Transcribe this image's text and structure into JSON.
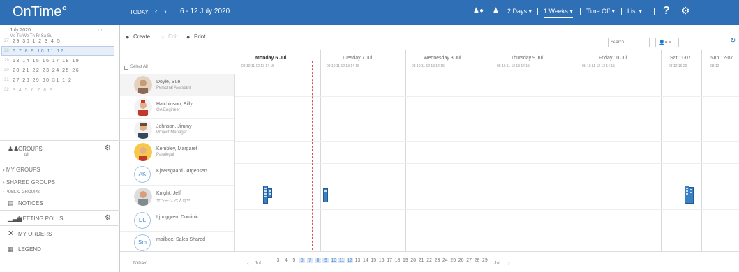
{
  "app": {
    "logo": "OnTime°"
  },
  "topbar": {
    "today": "TODAY",
    "prev": "‹",
    "next": "›",
    "date_range": "6 - 12 July 2020",
    "view_2days": "2 Days ▾",
    "view_1weeks": "1 Weeks ▾",
    "time_off": "Time Off ▾",
    "list": "List ▾",
    "help": "?",
    "settings": "⚙",
    "sep": "|"
  },
  "calendar": {
    "month": "July 2020",
    "nav": "‹ ›",
    "header": "Mo Tu We Th Fr Sa Su",
    "rows": [
      {
        "wk": "27",
        "days": "29 30  1  2  3  4  5"
      },
      {
        "wk": "28",
        "days": "6  7  8  9 10 11 12"
      },
      {
        "wk": "29",
        "days": "13 14 15 16 17 18 19"
      },
      {
        "wk": "30",
        "days": "20 21 22 23 24 25 26"
      },
      {
        "wk": "31",
        "days": "27 28 29 30 31  1  2"
      },
      {
        "wk": "32",
        "days": "3  4  5  6  7  8  9"
      }
    ]
  },
  "nav": {
    "groups": "GROUPS",
    "groups_all": "All",
    "my_groups": "› MY GROUPS",
    "shared_groups": "› SHARED GROUPS",
    "public_groups": "› PUBLIC GROUPS",
    "notices": "NOTICES",
    "meeting_polls": "MEETING POLLS",
    "my_orders": "MY ORDERS",
    "legend": "LEGEND"
  },
  "toolbar": {
    "create": "Create",
    "edit": "Edit",
    "print": "Print",
    "search_placeholder": "Search",
    "user_btn": "👤▾ ≡"
  },
  "grid": {
    "select_all": "Select All",
    "days": [
      {
        "label": "Monday 6 Jul",
        "hours": "08 10 11 12 13 14 15"
      },
      {
        "label": "Tuesday 7 Jul",
        "hours": "08 10 11 12 13 14 15"
      },
      {
        "label": "Wednesday 8 Jul",
        "hours": "08 10 11 12 13 14 15"
      },
      {
        "label": "Thursday 9 Jul",
        "hours": "08 10 11 12 13 14 15"
      },
      {
        "label": "Friday 10 Jul",
        "hours": "08 10 11 12 13 14 15"
      },
      {
        "label": "Sat 11-07",
        "hours": "08 12 16 20"
      },
      {
        "label": "Sun 12-07",
        "hours": "08 12"
      }
    ]
  },
  "people": [
    {
      "name": "Doyle, Sue",
      "title": "Personal Assistant",
      "initials": ""
    },
    {
      "name": "Hatchinson, Billy",
      "title": "QA Engineer",
      "initials": ""
    },
    {
      "name": "Johnson, Jimmy",
      "title": "Project Manager",
      "initials": ""
    },
    {
      "name": "Kembley, Margaret",
      "title": "Paralegal",
      "initials": ""
    },
    {
      "name": "Kjaersgaard Jørgensen...",
      "title": "",
      "initials": "AK"
    },
    {
      "name": "Knight, Jeff",
      "title": "サンテク ぺ人材**",
      "initials": ""
    },
    {
      "name": "Ljunggren, Dominic",
      "title": "",
      "initials": "DL"
    },
    {
      "name": "mailbox, Sales Shared",
      "title": "",
      "initials": "Sm"
    }
  ],
  "bottom": {
    "today": "TODAY",
    "prev": "‹",
    "month_start": "Jul",
    "month_end": "Jul",
    "next": "›",
    "days": [
      "3",
      "4",
      "5",
      "6",
      "7",
      "8",
      "9",
      "10",
      "11",
      "12",
      "13",
      "14",
      "15",
      "16",
      "17",
      "18",
      "19",
      "20",
      "21",
      "22",
      "23",
      "24",
      "25",
      "26",
      "27",
      "28",
      "29"
    ]
  },
  "colors": {
    "brand": "#2f6fb5",
    "appointment": "#3b7fc4",
    "now_line": "#d9534f"
  }
}
